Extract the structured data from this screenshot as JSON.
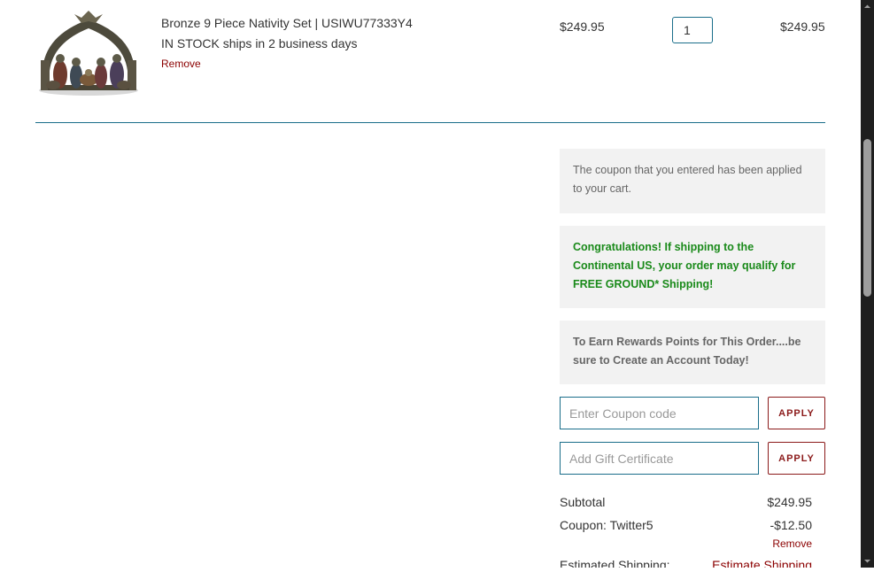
{
  "cart_item": {
    "title": "Bronze 9 Piece Nativity Set | USIWU77333Y4",
    "stock": "IN STOCK ships in 2 business days",
    "remove_label": "Remove",
    "price": "$249.95",
    "quantity": "1",
    "total": "$249.95",
    "image_icon": "nativity-set-thumbnail"
  },
  "notices": {
    "coupon_applied": "The coupon that you entered has been applied to your cart.",
    "free_shipping": "Congratulations! If shipping to the Continental US, your order may qualify for FREE GROUND* Shipping!",
    "rewards": "To Earn Rewards Points for This Order....be sure to Create an Account Today!"
  },
  "coupon": {
    "placeholder": "Enter Coupon code",
    "apply_label": "APPLY"
  },
  "gift": {
    "placeholder": "Add Gift Certificate",
    "apply_label": "APPLY"
  },
  "totals": {
    "subtotal_label": "Subtotal",
    "subtotal_value": "$249.95",
    "coupon_label": "Coupon: Twitter5",
    "coupon_value": "-$12.50",
    "coupon_remove_label": "Remove",
    "shipping_label": "Estimated Shipping:",
    "shipping_link": "Estimate Shipping"
  },
  "colors": {
    "accent_teal": "#1a6e8a",
    "remove_red": "#8b0000",
    "success_green": "#1a8a1a",
    "notice_bg": "#f2f2f2"
  }
}
